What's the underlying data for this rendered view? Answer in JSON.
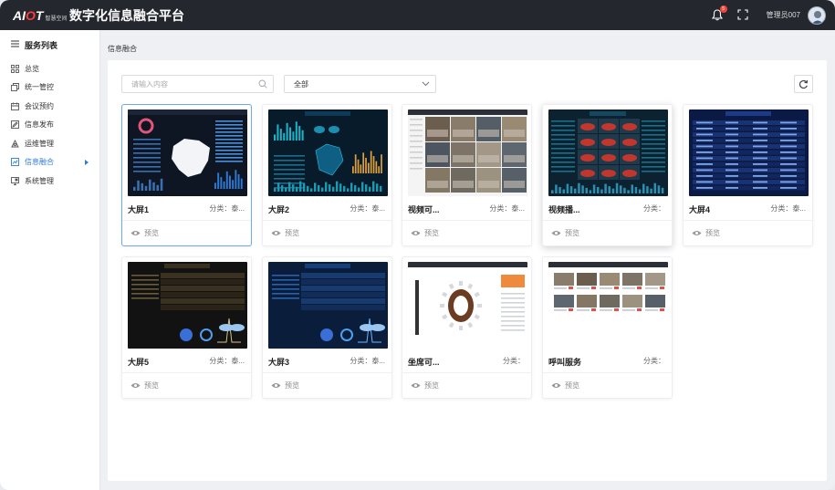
{
  "app": {
    "logo_main_1": "AI",
    "logo_main_accent": "O",
    "logo_main_2": "T",
    "logo_sub": "智慧空间",
    "title": "数字化信息融合平台",
    "notification_count": "5",
    "username": "管理员007"
  },
  "sidebar": {
    "header": "服务列表",
    "items": [
      {
        "label": "总览",
        "icon": "grid-icon"
      },
      {
        "label": "统一管控",
        "icon": "copy-icon"
      },
      {
        "label": "会议预约",
        "icon": "calendar-icon"
      },
      {
        "label": "信息发布",
        "icon": "edit-icon"
      },
      {
        "label": "运维管理",
        "icon": "tools-icon"
      },
      {
        "label": "信息融合",
        "icon": "fusion-icon",
        "active": true
      },
      {
        "label": "系统管理",
        "icon": "monitor-icon"
      }
    ]
  },
  "breadcrumb": "信息融合",
  "search": {
    "placeholder": "请输入内容"
  },
  "filter": {
    "selected": "全部"
  },
  "cards": [
    {
      "name": "大屏1",
      "category": "分类：泰...",
      "preview": "预览"
    },
    {
      "name": "大屏2",
      "category": "分类：泰...",
      "preview": "预览"
    },
    {
      "name": "视频可...",
      "category": "分类：泰...",
      "preview": "预览"
    },
    {
      "name": "视频播...",
      "category": "分类：",
      "preview": "预览"
    },
    {
      "name": "大屏4",
      "category": "分类：泰...",
      "preview": "预览"
    },
    {
      "name": "大屏5",
      "category": "分类：泰...",
      "preview": "预览"
    },
    {
      "name": "大屏3",
      "category": "分类：泰...",
      "preview": "预览"
    },
    {
      "name": "坐席可...",
      "category": "分类：",
      "preview": "预览"
    },
    {
      "name": "呼叫服务",
      "category": "分类：",
      "preview": "预览"
    }
  ],
  "colors": {
    "topbar": "#24272e",
    "accent": "#2b7bdc",
    "badge": "#f5453b"
  }
}
